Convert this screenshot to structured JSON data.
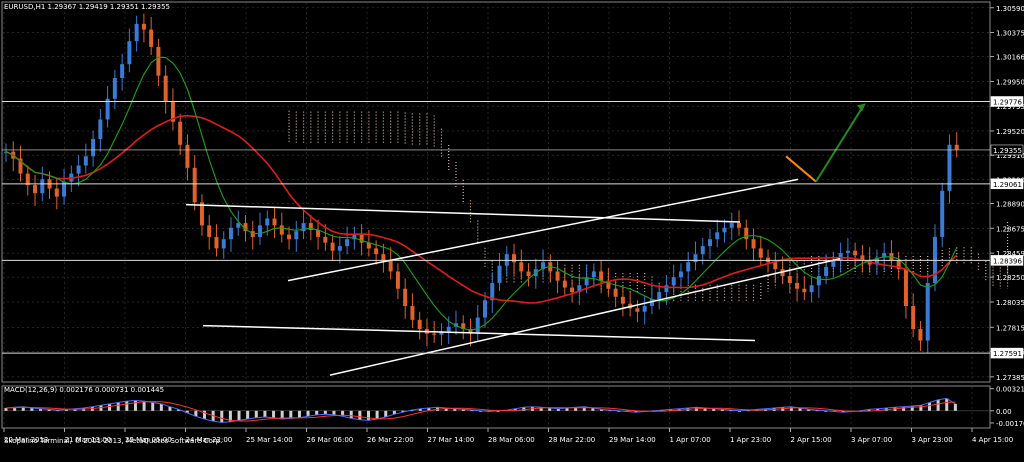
{
  "chart_data": {
    "type": "candlestick",
    "symbol_header": "EURUSD,H1  1.29367 1.29419 1.29351 1.29355",
    "price_axis_ticks": [
      "1.30590",
      "1.30375",
      "1.30166",
      "1.29950",
      "1.29735",
      "1.29520",
      "1.29310",
      "1.29100",
      "1.28890",
      "1.28675",
      "1.28459",
      "1.28250",
      "1.28035",
      "1.27815",
      "1.27605",
      "1.27385"
    ],
    "price_ylim": [
      1.2734,
      1.3064
    ],
    "price_tags": [
      {
        "value": 1.29776,
        "label": "1.29776",
        "style": "white"
      },
      {
        "value": 1.29355,
        "label": "1.29355",
        "style": "current"
      },
      {
        "value": 1.29061,
        "label": "1.29061",
        "style": "white"
      },
      {
        "value": 1.28396,
        "label": "1.28396",
        "style": "white"
      },
      {
        "value": 1.27591,
        "label": "1.27591",
        "style": "white"
      }
    ],
    "time_axis_ticks": [
      "20 Mar 2013",
      "21 Mar 13:00",
      "22 Mar 05:00",
      "24 Mar 22:00",
      "25 Mar 14:00",
      "26 Mar 06:00",
      "26 Mar 22:00",
      "27 Mar 14:00",
      "28 Mar 06:00",
      "28 Mar 22:00",
      "29 Mar 14:00",
      "1 Apr 07:00",
      "1 Apr 23:00",
      "2 Apr 15:00",
      "3 Apr 07:00",
      "3 Apr 23:00",
      "4 Apr 15:00"
    ],
    "close_series": [
      1.2934,
      1.2928,
      1.2915,
      1.2905,
      1.2898,
      1.291,
      1.2902,
      1.2895,
      1.2908,
      1.2915,
      1.2922,
      1.293,
      1.2945,
      1.2962,
      1.298,
      1.2998,
      1.301,
      1.303,
      1.3045,
      1.304,
      1.3025,
      1.3,
      1.2978,
      1.296,
      1.294,
      1.292,
      1.289,
      1.287,
      1.286,
      1.285,
      1.2858,
      1.2868,
      1.2872,
      1.2865,
      1.286,
      1.287,
      1.2876,
      1.287,
      1.2862,
      1.2858,
      1.2865,
      1.2872,
      1.2866,
      1.286,
      1.2855,
      1.2848,
      1.2852,
      1.2858,
      1.2862,
      1.2855,
      1.285,
      1.2845,
      1.284,
      1.283,
      1.2815,
      1.28,
      1.2788,
      1.278,
      1.2776,
      1.2775,
      1.2778,
      1.2782,
      1.2785,
      1.278,
      1.2776,
      1.279,
      1.2805,
      1.282,
      1.2835,
      1.2845,
      1.2838,
      1.283,
      1.2826,
      1.2832,
      1.2838,
      1.283,
      1.2822,
      1.2816,
      1.2812,
      1.2818,
      1.2825,
      1.283,
      1.2822,
      1.2815,
      1.2808,
      1.2802,
      1.2798,
      1.2795,
      1.28,
      1.2806,
      1.2812,
      1.2818,
      1.2825,
      1.283,
      1.2838,
      1.2845,
      1.2852,
      1.2858,
      1.2864,
      1.2868,
      1.2872,
      1.2868,
      1.2858,
      1.285,
      1.2842,
      1.2838,
      1.2832,
      1.2826,
      1.282,
      1.2815,
      1.2812,
      1.2818,
      1.2826,
      1.2834,
      1.284,
      1.2846,
      1.2848,
      1.2844,
      1.284,
      1.2836,
      1.2842,
      1.2846,
      1.284,
      1.2832,
      1.28,
      1.278,
      1.277,
      1.282,
      1.286,
      1.29,
      1.294,
      1.2936
    ],
    "macd_header": "MACD(12,26,9) 0.002176 0.000731 0.001445",
    "macd_ticks": [
      "0.003211",
      "0.00",
      "-0.001767"
    ],
    "macd_ylim": [
      -0.0025,
      0.0036
    ],
    "macd_histogram": [
      0.0004,
      0.0005,
      0.0006,
      0.0004,
      0.0003,
      0.0002,
      0.0001,
      0.0002,
      0.0003,
      0.0004,
      0.0006,
      0.0008,
      0.001,
      0.0012,
      0.0014,
      0.0015,
      0.0014,
      0.0012,
      0.001,
      0.0006,
      0.0002,
      -0.0003,
      -0.0008,
      -0.0012,
      -0.0015,
      -0.0017,
      -0.0016,
      -0.0014,
      -0.0012,
      -0.001,
      -0.0009,
      -0.001,
      -0.0012,
      -0.0011,
      -0.001,
      -0.0008,
      -0.0006,
      -0.0005,
      -0.0006,
      -0.0008,
      -0.0011,
      -0.0013,
      -0.0014,
      -0.0012,
      -0.0009,
      -0.0005,
      -0.0002,
      0.0001,
      0.0003,
      0.0004,
      0.0005,
      0.0004,
      0.0003,
      0.0002,
      0.0001,
      0.0,
      -0.0001,
      0.0,
      0.0001,
      0.0003,
      0.0005,
      0.0006,
      0.0005,
      0.0004,
      0.0003,
      0.0004,
      0.0005,
      0.0006,
      0.0004,
      0.0002,
      0.0001,
      0.0,
      -0.0001,
      -0.0002,
      -0.0001,
      0.0,
      0.0001,
      0.0002,
      0.0003,
      0.0004,
      0.0005,
      0.0004,
      0.0003,
      0.0002,
      0.0001,
      0.0,
      0.0001,
      0.0002,
      0.0003,
      0.0004,
      0.0005,
      0.0006,
      0.0004,
      0.0002,
      0.0001,
      0.0,
      -0.0001,
      -0.0002,
      -0.0001,
      0.0,
      0.0002,
      0.0003,
      0.0004,
      0.0005,
      0.0006,
      0.0007,
      0.0008,
      0.0012,
      0.0016,
      0.0018,
      0.001
    ]
  },
  "watermark": "Skopalino Terminal, © 2001-2013, MetaQuotes Software Corp.",
  "colors": {
    "background": "#000000",
    "grid": "#3c3c3c",
    "bull": "#3a7bd5",
    "bear": "#e0622a",
    "ma_red": "#e21b1b",
    "ma_green": "#1aa31a",
    "cloud": "#d8b89a",
    "trendline": "#ffffff",
    "arrow_green": "#1e8c1e",
    "arrow_orange": "#ff8c00",
    "macd_line": "#4a6cff",
    "signal_line": "#ff3030",
    "current_tag": "#ffffff"
  }
}
